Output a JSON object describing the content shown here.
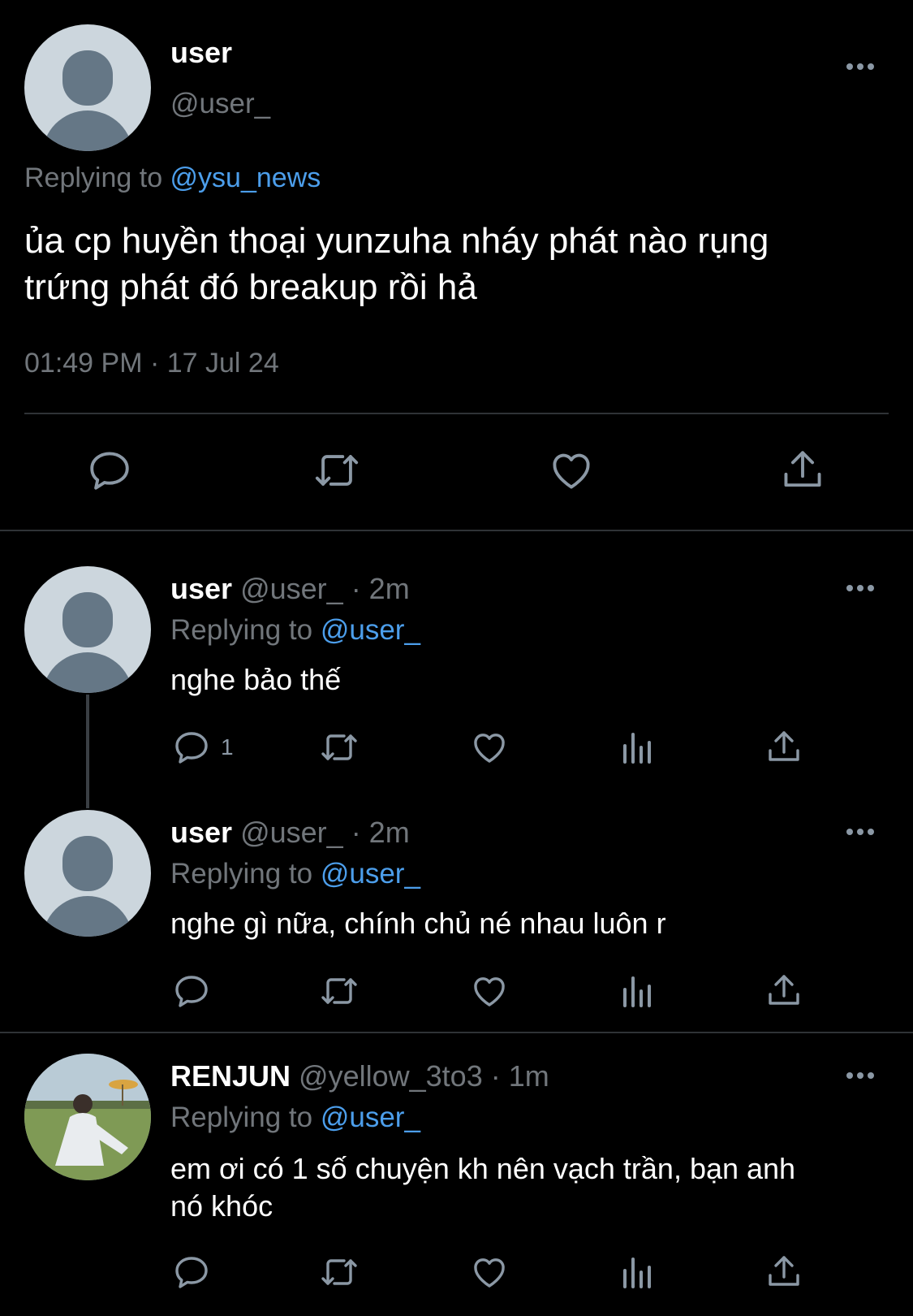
{
  "main_tweet": {
    "name": "user",
    "handle": "@user_",
    "replying_prefix": "Replying to ",
    "replying_to": "@ysu_news",
    "text_line1": "ủa cp huyền thoại yunzuha nháy phát nào rụng",
    "text_line2": "trứng phát đó breakup rồi hả",
    "timestamp": "01:49 PM · 17 Jul 24"
  },
  "replies": [
    {
      "name": "user",
      "handle": "@user_",
      "time": "· 2m",
      "replying_prefix": "Replying to ",
      "replying_to": "@user_",
      "text": "nghe bảo thế",
      "reply_count": "1"
    },
    {
      "name": "user",
      "handle": "@user_",
      "time": "· 2m",
      "replying_prefix": "Replying to ",
      "replying_to": "@user_",
      "text": "nghe gì nữa, chính chủ né nhau luôn r",
      "reply_count": ""
    },
    {
      "name": "RENJUN",
      "handle": "@yellow_3to3",
      "time": "· 1m",
      "replying_prefix": "Replying to ",
      "replying_to": "@user_",
      "text_line1": "em ơi có 1 số chuyện kh nên vạch trần, bạn anh",
      "text_line2": "nó khóc",
      "reply_count": ""
    }
  ],
  "icons": [
    "more-icon",
    "reply-icon",
    "retweet-icon",
    "like-icon",
    "views-icon",
    "share-icon"
  ],
  "colors": {
    "background": "#000000",
    "link": "#4c9eeb",
    "muted": "#71767b",
    "divider": "#2f3336"
  }
}
